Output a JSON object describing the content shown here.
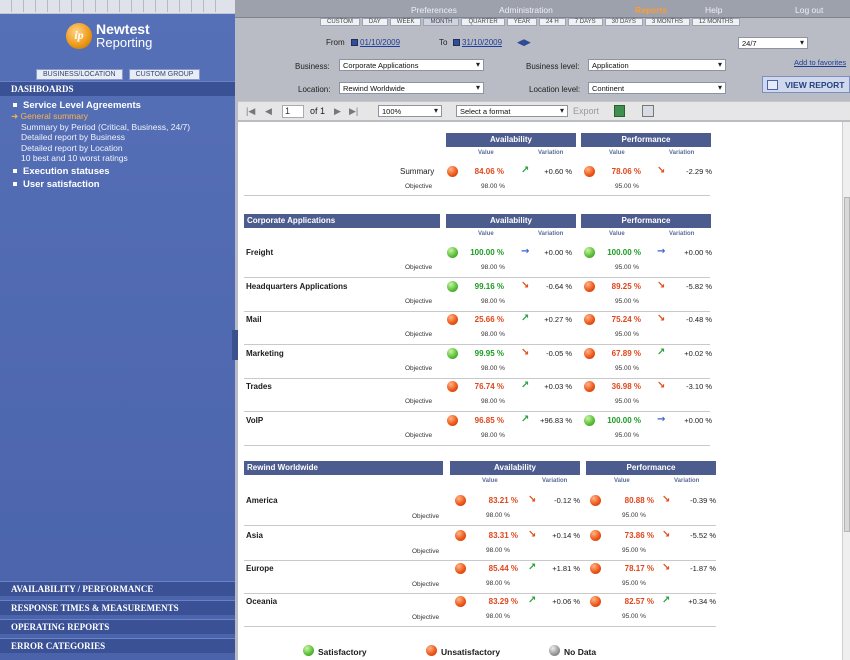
{
  "topbar": {
    "menu": [
      "Preferences",
      "Administration",
      "Reports",
      "Help",
      "Log out"
    ],
    "active": "Reports"
  },
  "sidebar": {
    "logo_line1": "Newtest",
    "logo_line2": "Reporting",
    "logo_mark": "ip",
    "group_tabs": [
      "BUSINESS/LOCATION",
      "CUSTOM GROUP"
    ],
    "dashboards": "DASHBOARDS",
    "sla_title": "Service Level Agreements",
    "sla_items": [
      "General summary",
      "Summary by Period (Critical, Business, 24/7)",
      "Detailed report by Business",
      "Detailed report by Location",
      "10 best and 10 worst ratings"
    ],
    "execution": "Execution statuses",
    "satisfaction": "User satisfaction",
    "sections": [
      "AVAILABILITY / PERFORMANCE",
      "RESPONSE TIMES & MEASUREMENTS",
      "OPERATING REPORTS",
      "ERROR CATEGORIES"
    ]
  },
  "filters": {
    "periods": [
      "CUSTOM",
      "DAY",
      "WEEK",
      "MONTH",
      "QUARTER",
      "YEAR",
      "24 H",
      "7 DAYS",
      "30 DAYS",
      "3 MONTHS",
      "12 MONTHS"
    ],
    "active_period": "MONTH",
    "from_label": "From",
    "from_date": "01/10/2009",
    "to_label": "To",
    "to_date": "31/10/2009",
    "timeslot": "24/7",
    "business_label": "Business:",
    "business": "Corporate Applications",
    "business_level_label": "Business level:",
    "business_level": "Application",
    "location_label": "Location:",
    "location": "Rewind Worldwide",
    "location_level_label": "Location level:",
    "location_level": "Continent",
    "add_favorites": "Add to favorites",
    "view_report": "VIEW REPORT"
  },
  "toolbar": {
    "page": "1",
    "of": "of 1",
    "zoom": "100%",
    "format": "Select a format",
    "export": "Export"
  },
  "labels": {
    "availability": "Availability",
    "performance": "Performance",
    "value": "Value",
    "variation": "Variation",
    "objective": "Objective"
  },
  "summary": {
    "name": "Summary",
    "avail": {
      "value": "84.06 %",
      "status": "red",
      "trend": "up",
      "variation": "+0.60 %",
      "objective": "98.00 %"
    },
    "perf": {
      "value": "78.06 %",
      "status": "red",
      "trend": "down",
      "variation": "-2.29 %",
      "objective": "95.00 %"
    }
  },
  "groups": [
    {
      "title": "Corporate Applications",
      "rows": [
        {
          "name": "Freight",
          "avail": {
            "value": "100.00 %",
            "status": "green",
            "trend": "flat",
            "variation": "+0.00 %",
            "objective": "98.00 %"
          },
          "perf": {
            "value": "100.00 %",
            "status": "green",
            "trend": "flat",
            "variation": "+0.00 %",
            "objective": "95.00 %"
          }
        },
        {
          "name": "Headquarters Applications",
          "avail": {
            "value": "99.16 %",
            "status": "green",
            "trend": "down",
            "variation": "-0.64 %",
            "objective": "98.00 %"
          },
          "perf": {
            "value": "89.25 %",
            "status": "red",
            "trend": "down",
            "variation": "-5.82 %",
            "objective": "95.00 %"
          }
        },
        {
          "name": "Mail",
          "avail": {
            "value": "25.66 %",
            "status": "red",
            "trend": "up",
            "variation": "+0.27 %",
            "objective": "98.00 %"
          },
          "perf": {
            "value": "75.24 %",
            "status": "red",
            "trend": "down",
            "variation": "-0.48 %",
            "objective": "95.00 %"
          }
        },
        {
          "name": "Marketing",
          "avail": {
            "value": "99.95 %",
            "status": "green",
            "trend": "down",
            "variation": "-0.05 %",
            "objective": "98.00 %"
          },
          "perf": {
            "value": "67.89 %",
            "status": "red",
            "trend": "up",
            "variation": "+0.02 %",
            "objective": "95.00 %"
          }
        },
        {
          "name": "Trades",
          "avail": {
            "value": "76.74 %",
            "status": "red",
            "trend": "up",
            "variation": "+0.03 %",
            "objective": "98.00 %"
          },
          "perf": {
            "value": "36.98 %",
            "status": "red",
            "trend": "down",
            "variation": "-3.10 %",
            "objective": "95.00 %"
          }
        },
        {
          "name": "VoIP",
          "avail": {
            "value": "96.85 %",
            "status": "red",
            "trend": "up",
            "variation": "+96.83 %",
            "objective": "98.00 %"
          },
          "perf": {
            "value": "100.00 %",
            "status": "green",
            "trend": "flat",
            "variation": "+0.00 %",
            "objective": "95.00 %"
          }
        }
      ]
    },
    {
      "title": "Rewind Worldwide",
      "rows": [
        {
          "name": "America",
          "avail": {
            "value": "83.21 %",
            "status": "red",
            "trend": "down",
            "variation": "-0.12 %",
            "objective": "98.00 %"
          },
          "perf": {
            "value": "80.88 %",
            "status": "red",
            "trend": "down",
            "variation": "-0.39 %",
            "objective": "95.00 %"
          }
        },
        {
          "name": "Asia",
          "avail": {
            "value": "83.31 %",
            "status": "red",
            "trend": "down",
            "variation": "+0.14 %",
            "objective": "98.00 %"
          },
          "perf": {
            "value": "73.86 %",
            "status": "red",
            "trend": "down",
            "variation": "-5.52 %",
            "objective": "95.00 %"
          }
        },
        {
          "name": "Europe",
          "avail": {
            "value": "85.44 %",
            "status": "red",
            "trend": "up",
            "variation": "+1.81 %",
            "objective": "98.00 %"
          },
          "perf": {
            "value": "78.17 %",
            "status": "red",
            "trend": "down",
            "variation": "-1.87 %",
            "objective": "95.00 %"
          }
        },
        {
          "name": "Oceania",
          "avail": {
            "value": "83.29 %",
            "status": "red",
            "trend": "up",
            "variation": "+0.06 %",
            "objective": "98.00 %"
          },
          "perf": {
            "value": "82.57 %",
            "status": "red",
            "trend": "up",
            "variation": "+0.34 %",
            "objective": "95.00 %"
          }
        }
      ]
    }
  ],
  "legend": [
    {
      "label": "Satisfactory",
      "status": "green"
    },
    {
      "label": "Unsatisfactory",
      "status": "red"
    },
    {
      "label": "No Data",
      "status": "grey"
    }
  ],
  "colors": {
    "sidebar": "#4a63ab",
    "header": "#4d5c8e",
    "red": "#e0461b",
    "green": "#1b9b23",
    "accent": "#ff9b31"
  }
}
